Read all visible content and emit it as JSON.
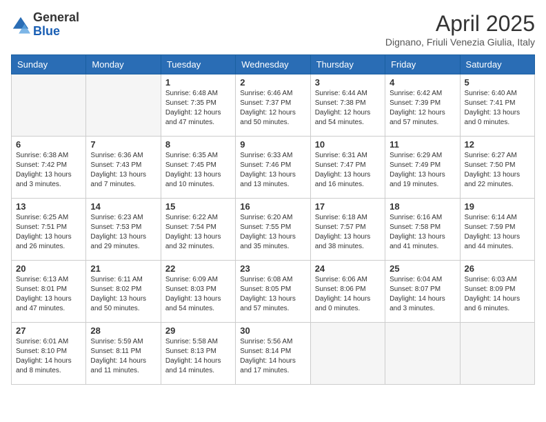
{
  "header": {
    "logo_line1": "General",
    "logo_line2": "Blue",
    "title": "April 2025",
    "subtitle": "Dignano, Friuli Venezia Giulia, Italy"
  },
  "weekdays": [
    "Sunday",
    "Monday",
    "Tuesday",
    "Wednesday",
    "Thursday",
    "Friday",
    "Saturday"
  ],
  "weeks": [
    [
      {
        "day": "",
        "info": ""
      },
      {
        "day": "",
        "info": ""
      },
      {
        "day": "1",
        "info": "Sunrise: 6:48 AM\nSunset: 7:35 PM\nDaylight: 12 hours and 47 minutes."
      },
      {
        "day": "2",
        "info": "Sunrise: 6:46 AM\nSunset: 7:37 PM\nDaylight: 12 hours and 50 minutes."
      },
      {
        "day": "3",
        "info": "Sunrise: 6:44 AM\nSunset: 7:38 PM\nDaylight: 12 hours and 54 minutes."
      },
      {
        "day": "4",
        "info": "Sunrise: 6:42 AM\nSunset: 7:39 PM\nDaylight: 12 hours and 57 minutes."
      },
      {
        "day": "5",
        "info": "Sunrise: 6:40 AM\nSunset: 7:41 PM\nDaylight: 13 hours and 0 minutes."
      }
    ],
    [
      {
        "day": "6",
        "info": "Sunrise: 6:38 AM\nSunset: 7:42 PM\nDaylight: 13 hours and 3 minutes."
      },
      {
        "day": "7",
        "info": "Sunrise: 6:36 AM\nSunset: 7:43 PM\nDaylight: 13 hours and 7 minutes."
      },
      {
        "day": "8",
        "info": "Sunrise: 6:35 AM\nSunset: 7:45 PM\nDaylight: 13 hours and 10 minutes."
      },
      {
        "day": "9",
        "info": "Sunrise: 6:33 AM\nSunset: 7:46 PM\nDaylight: 13 hours and 13 minutes."
      },
      {
        "day": "10",
        "info": "Sunrise: 6:31 AM\nSunset: 7:47 PM\nDaylight: 13 hours and 16 minutes."
      },
      {
        "day": "11",
        "info": "Sunrise: 6:29 AM\nSunset: 7:49 PM\nDaylight: 13 hours and 19 minutes."
      },
      {
        "day": "12",
        "info": "Sunrise: 6:27 AM\nSunset: 7:50 PM\nDaylight: 13 hours and 22 minutes."
      }
    ],
    [
      {
        "day": "13",
        "info": "Sunrise: 6:25 AM\nSunset: 7:51 PM\nDaylight: 13 hours and 26 minutes."
      },
      {
        "day": "14",
        "info": "Sunrise: 6:23 AM\nSunset: 7:53 PM\nDaylight: 13 hours and 29 minutes."
      },
      {
        "day": "15",
        "info": "Sunrise: 6:22 AM\nSunset: 7:54 PM\nDaylight: 13 hours and 32 minutes."
      },
      {
        "day": "16",
        "info": "Sunrise: 6:20 AM\nSunset: 7:55 PM\nDaylight: 13 hours and 35 minutes."
      },
      {
        "day": "17",
        "info": "Sunrise: 6:18 AM\nSunset: 7:57 PM\nDaylight: 13 hours and 38 minutes."
      },
      {
        "day": "18",
        "info": "Sunrise: 6:16 AM\nSunset: 7:58 PM\nDaylight: 13 hours and 41 minutes."
      },
      {
        "day": "19",
        "info": "Sunrise: 6:14 AM\nSunset: 7:59 PM\nDaylight: 13 hours and 44 minutes."
      }
    ],
    [
      {
        "day": "20",
        "info": "Sunrise: 6:13 AM\nSunset: 8:01 PM\nDaylight: 13 hours and 47 minutes."
      },
      {
        "day": "21",
        "info": "Sunrise: 6:11 AM\nSunset: 8:02 PM\nDaylight: 13 hours and 50 minutes."
      },
      {
        "day": "22",
        "info": "Sunrise: 6:09 AM\nSunset: 8:03 PM\nDaylight: 13 hours and 54 minutes."
      },
      {
        "day": "23",
        "info": "Sunrise: 6:08 AM\nSunset: 8:05 PM\nDaylight: 13 hours and 57 minutes."
      },
      {
        "day": "24",
        "info": "Sunrise: 6:06 AM\nSunset: 8:06 PM\nDaylight: 14 hours and 0 minutes."
      },
      {
        "day": "25",
        "info": "Sunrise: 6:04 AM\nSunset: 8:07 PM\nDaylight: 14 hours and 3 minutes."
      },
      {
        "day": "26",
        "info": "Sunrise: 6:03 AM\nSunset: 8:09 PM\nDaylight: 14 hours and 6 minutes."
      }
    ],
    [
      {
        "day": "27",
        "info": "Sunrise: 6:01 AM\nSunset: 8:10 PM\nDaylight: 14 hours and 8 minutes."
      },
      {
        "day": "28",
        "info": "Sunrise: 5:59 AM\nSunset: 8:11 PM\nDaylight: 14 hours and 11 minutes."
      },
      {
        "day": "29",
        "info": "Sunrise: 5:58 AM\nSunset: 8:13 PM\nDaylight: 14 hours and 14 minutes."
      },
      {
        "day": "30",
        "info": "Sunrise: 5:56 AM\nSunset: 8:14 PM\nDaylight: 14 hours and 17 minutes."
      },
      {
        "day": "",
        "info": ""
      },
      {
        "day": "",
        "info": ""
      },
      {
        "day": "",
        "info": ""
      }
    ]
  ]
}
